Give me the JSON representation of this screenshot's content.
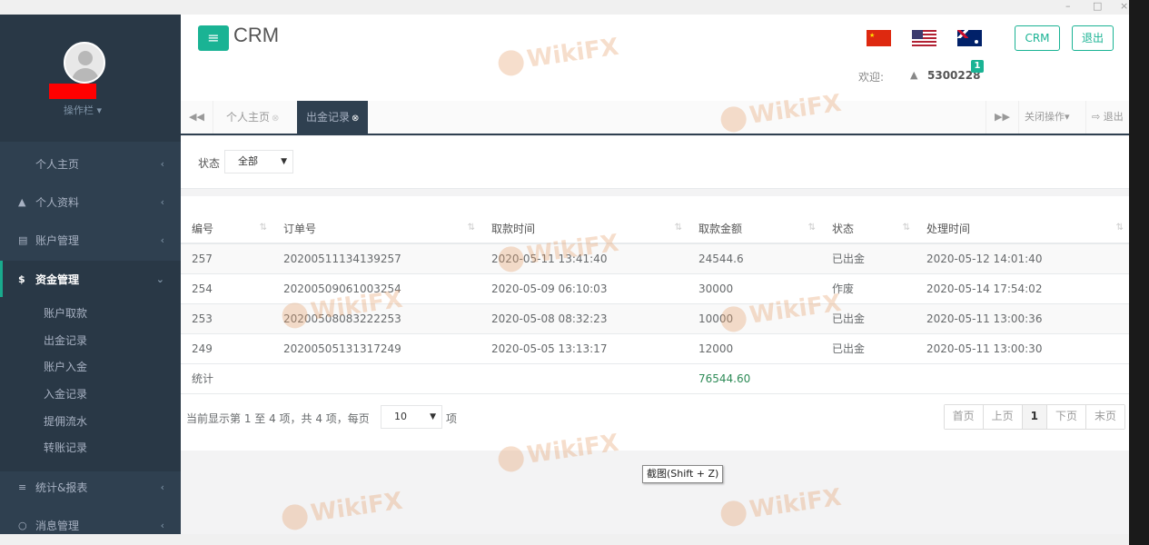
{
  "window": {
    "minimize": "–",
    "maximize": "□",
    "close": "×"
  },
  "sidebar": {
    "op_label": "操作栏 ▾",
    "items": [
      {
        "icon": "",
        "label": "个人主页",
        "chev": "‹"
      },
      {
        "icon": "▲",
        "label": "个人资料",
        "chev": "‹"
      },
      {
        "icon": "▤",
        "label": "账户管理",
        "chev": "‹"
      },
      {
        "icon": "$",
        "label": "资金管理",
        "chev": "⌄"
      },
      {
        "icon": "≡",
        "label": "统计&报表",
        "chev": "‹"
      },
      {
        "icon": "○",
        "label": "消息管理",
        "chev": "‹"
      }
    ],
    "subitems": [
      "账户取款",
      "出金记录",
      "账户入金",
      "入金记录",
      "提佣流水",
      "转账记录"
    ]
  },
  "header": {
    "brand": "CRM",
    "menu_icon": "≡",
    "crm_button": "CRM",
    "logout_button": "退出",
    "welcome": "欢迎:",
    "user_icon": "▲",
    "user_id": "5300228",
    "badge": "1"
  },
  "tabs": {
    "prev": "◀◀",
    "next": "▶▶",
    "items": [
      {
        "label": "个人主页",
        "close": "⊗"
      },
      {
        "label": "出金记录",
        "close": "⊗"
      }
    ],
    "close_ops": "关闭操作▾",
    "exit": "⇨ 退出"
  },
  "filter": {
    "label": "状态",
    "selected": "全部",
    "arrow": "▼"
  },
  "table": {
    "columns": [
      {
        "label": "编号",
        "sort": "⇅"
      },
      {
        "label": "订单号",
        "sort": "⇅"
      },
      {
        "label": "取款时间",
        "sort": "⇅"
      },
      {
        "label": "取款金额",
        "sort": "⇅"
      },
      {
        "label": "状态",
        "sort": "⇅"
      },
      {
        "label": "处理时间",
        "sort": "⇅"
      }
    ],
    "rows": [
      [
        "257",
        "20200511134139257",
        "2020-05-11 13:41:40",
        "24544.6",
        "已出金",
        "2020-05-12 14:01:40"
      ],
      [
        "254",
        "20200509061003254",
        "2020-05-09 06:10:03",
        "30000",
        "作废",
        "2020-05-14 17:54:02"
      ],
      [
        "253",
        "20200508083222253",
        "2020-05-08 08:32:23",
        "10000",
        "已出金",
        "2020-05-11 13:00:36"
      ],
      [
        "249",
        "20200505131317249",
        "2020-05-05 13:13:17",
        "12000",
        "已出金",
        "2020-05-11 13:00:30"
      ]
    ],
    "total_label": "统计",
    "total_amount": "76544.60"
  },
  "pager": {
    "info": "当前显示第 1 至 4 项，共 4 项，每页",
    "page_size": "10",
    "arrow": "▼",
    "suffix": "项",
    "buttons": [
      "首页",
      "上页",
      "1",
      "下页",
      "末页"
    ]
  },
  "tooltip": "截图(Shift + Z)",
  "watermark": "WikiFX",
  "colors": {
    "sidebar_bg": "#2f4050",
    "accent": "#1ab394",
    "total": "#2e8b57",
    "redaction": "#ff0000"
  }
}
